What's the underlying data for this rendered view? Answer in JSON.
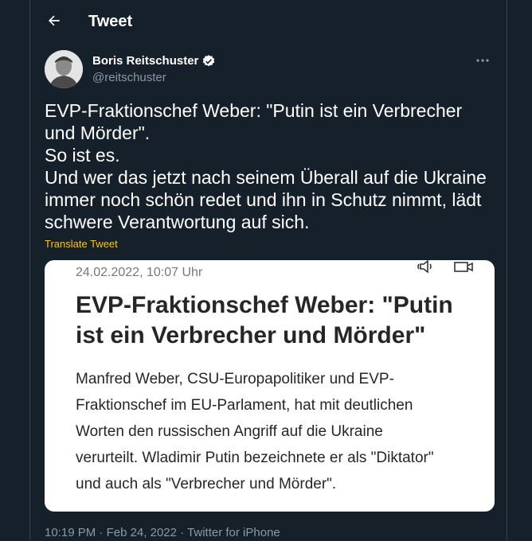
{
  "header": {
    "title": "Tweet"
  },
  "author": {
    "name": "Boris Reitschuster",
    "handle": "@reitschuster"
  },
  "tweet": {
    "lines": [
      "EVP-Fraktionschef Weber: \"Putin ist ein Verbrecher",
      "und Mörder\".",
      "So ist es.",
      "Und wer das jetzt nach seinem Überall auf die Ukraine",
      "immer noch schön redet und ihn in Schutz nimmt, lädt",
      "schwere Verantwortung auf sich."
    ],
    "translate_label": "Translate Tweet"
  },
  "card": {
    "date": "24.02.2022, 10:07 Uhr",
    "headline": [
      "EVP-Fraktionschef Weber: \"Putin",
      "ist ein Verbrecher und Mörder\""
    ],
    "body": [
      "Manfred Weber, CSU-Europapolitiker und EVP-",
      "Fraktionschef im EU-Parlament, hat mit deutlichen",
      "Worten den russischen Angriff auf die Ukraine",
      "verurteilt. Wladimir Putin bezeichnete er als \"Diktator\"",
      "und auch als \"Verbrecher und Mörder\"."
    ]
  },
  "meta": {
    "time": "10:19 PM",
    "sep1": " · ",
    "date": "Feb 24, 2022",
    "sep2": " · ",
    "source": "Twitter for iPhone"
  },
  "icons": {
    "back": "arrow-left-icon",
    "verified": "verified-badge-icon",
    "more": "more-horizontal-icon",
    "audio": "speaker-icon",
    "video": "video-camera-icon"
  },
  "colors": {
    "background": "#15202b",
    "text": "#ffffff",
    "muted": "#8b98a5",
    "translate": "#f5c518",
    "verified": "#ffffff"
  }
}
